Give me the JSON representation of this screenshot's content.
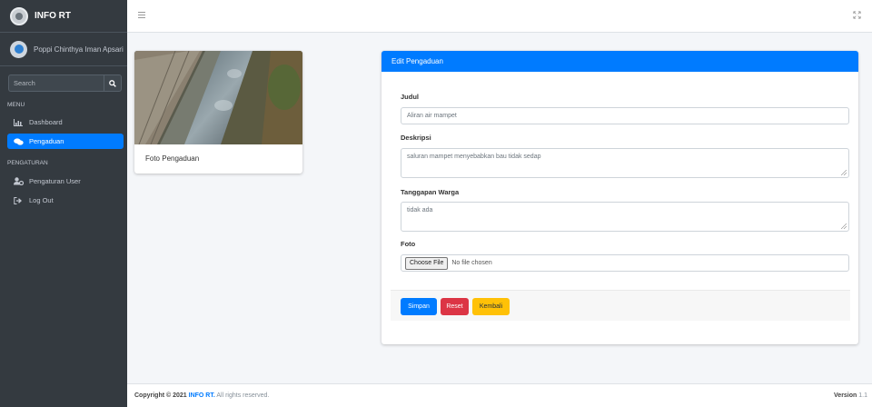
{
  "brand": {
    "name": "INFO RT"
  },
  "user": {
    "name": "Poppi Chinthya Iman Apsari"
  },
  "search": {
    "placeholder": "Search"
  },
  "sidebar": {
    "menu_header": "MENU",
    "settings_header": "PENGATURAN",
    "items": [
      {
        "label": "Dashboard",
        "icon": "chart-icon"
      },
      {
        "label": "Pengaduan",
        "icon": "comments-icon",
        "active": true
      },
      {
        "label": "Pengaturan User",
        "icon": "users-cog-icon"
      },
      {
        "label": "Log Out",
        "icon": "sign-out-icon"
      }
    ]
  },
  "photo_card": {
    "caption": "Foto Pengaduan"
  },
  "form": {
    "title": "Edit Pengaduan",
    "judul": {
      "label": "Judul",
      "value": "Aliran air mampet"
    },
    "deskripsi": {
      "label": "Deskripsi",
      "value": "saluran mampet menyebabkan bau tidak sedap"
    },
    "tanggapan": {
      "label": "Tanggapan Warga",
      "value": "tidak ada"
    },
    "foto": {
      "label": "Foto",
      "button": "Choose File",
      "status": "No file chosen"
    },
    "buttons": {
      "save": "Simpan",
      "reset": "Reset",
      "back": "Kembali"
    }
  },
  "footer": {
    "copyright_prefix": "Copyright © 2021",
    "brand": "INFO RT.",
    "rights": "All rights reserved.",
    "version_label": "Version",
    "version_value": "1.1"
  },
  "colors": {
    "primary": "#007bff",
    "danger": "#dc3545",
    "warning": "#ffc107",
    "sidebar": "#343a40"
  }
}
